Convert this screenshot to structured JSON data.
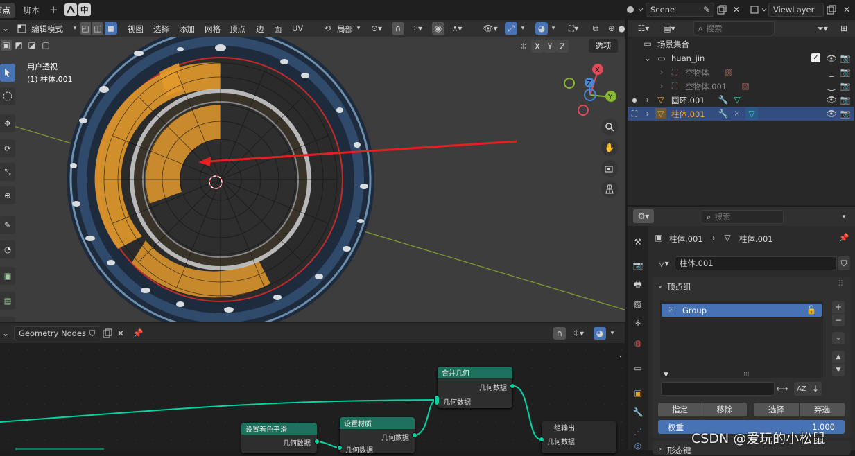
{
  "top_tabs": [
    "节点",
    "脚本"
  ],
  "add_tab": "+",
  "lang_toggle": "中",
  "viewport": {
    "mode": "编辑模式",
    "menus": [
      "视图",
      "选择",
      "添加",
      "网格",
      "顶点",
      "边",
      "面",
      "UV"
    ],
    "pivot": "局部",
    "view_name": "用户透视",
    "object_name": "(1) 柱体.001",
    "axis_buttons": [
      "X",
      "Y",
      "Z"
    ],
    "options_label": "选项",
    "gizmo_labels": [
      "X",
      "Z",
      "Y"
    ]
  },
  "node_editor": {
    "tree_name": "Geometry Nodes",
    "nodes": [
      {
        "title": "合并几何",
        "output": "几何数据",
        "input": "几何数据"
      },
      {
        "title": "设置着色平滑",
        "output": "几何数据"
      },
      {
        "title": "设置材质",
        "output": "几何数据",
        "input": "几何数据"
      },
      {
        "title": "组输出",
        "input": "几何数据"
      }
    ]
  },
  "outliner": {
    "scene": "Scene",
    "view_layer": "ViewLayer",
    "search_placeholder": "搜索",
    "items": [
      {
        "label": "场景集合",
        "depth": 0
      },
      {
        "label": "huan_jin",
        "depth": 1
      },
      {
        "label": "空物体",
        "depth": 2
      },
      {
        "label": "空物体.001",
        "depth": 2
      },
      {
        "label": "圆环.001",
        "depth": 1
      },
      {
        "label": "柱体.001",
        "depth": 1
      }
    ]
  },
  "properties": {
    "search_placeholder": "搜索",
    "breadcrumb": [
      "柱体.001",
      "柱体.001"
    ],
    "mesh_name": "柱体.001",
    "vertex_groups_title": "顶点组",
    "vertex_groups": [
      "Group"
    ],
    "assign_buttons": [
      "指定",
      "移除",
      "选择",
      "弃选"
    ],
    "weight_label": "权重",
    "weight_value": "1.000",
    "next_panel": "形态键"
  },
  "watermark": "CSDN @爱玩的小松鼠",
  "colors": {
    "accent": "#4772b3",
    "node_header": "#1d725e",
    "socket": "#00d6a3",
    "selection_orange": "#f0a030"
  }
}
